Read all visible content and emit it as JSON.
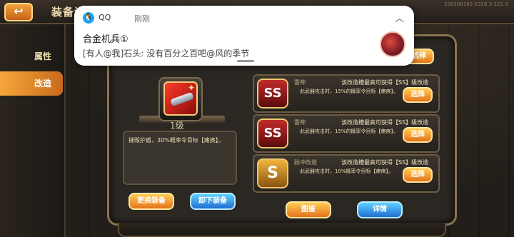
{
  "header": {
    "back_icon": "back-arrow-icon",
    "title": "装备详情",
    "build": "100100182-2316.3-121-3"
  },
  "sidebar": {
    "items": [
      {
        "label": "属性",
        "active": false
      },
      {
        "label": "改造",
        "active": true
      }
    ]
  },
  "equipment": {
    "level": "1级",
    "description": "摧毁护盾，30%概率令目标【瘫痪】。"
  },
  "buttons": {
    "replace": "更换装备",
    "unequip": "卸下装备",
    "atlas": "图鉴",
    "details": "详情"
  },
  "slots": [
    {
      "badge": "SS",
      "name": "雷神",
      "rule": "该改造槽最高可获得【SS】级改造",
      "desc": "此武器攻击时，15%的概率令目标【瘫痪】。",
      "select": "选择"
    },
    {
      "badge": "SS",
      "name": "雷神",
      "rule": "该改造槽最高可获得【SS】级改造",
      "desc": "此武器攻击时，15%的概率令目标【瘫痪】。",
      "select": "选择"
    },
    {
      "badge": "S",
      "name": "脉冲改造",
      "rule": "该改造槽最高可获得【SS】级改造",
      "desc": "此武器攻击时，10%概率令目标【瘫痪】。",
      "select": "选择"
    }
  ],
  "top_slot": {
    "select": "选择"
  },
  "notification": {
    "app": "QQ",
    "time": "刚刚",
    "title": "合金机兵①",
    "body": "[有人@我]石头: 没有百分之百吧@风的季节",
    "icon": "qq-penguin-icon",
    "chevron": "chevron-up-icon"
  },
  "colors": {
    "accent_orange": "#e3741a",
    "accent_blue": "#1f6fd2",
    "panel_border": "#8a7451"
  }
}
